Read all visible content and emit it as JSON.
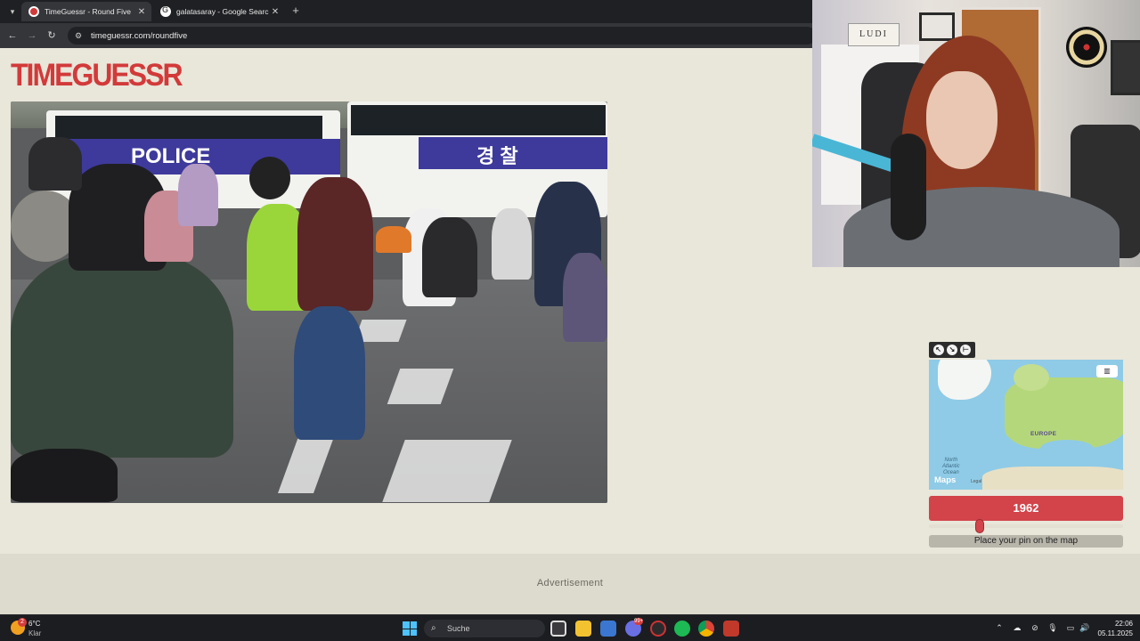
{
  "browser": {
    "tabs": [
      {
        "title": "TimeGuessr - Round Five",
        "active": true
      },
      {
        "title": "galatasaray - Google Search",
        "active": false
      }
    ],
    "url": "timeguessr.com/roundfive"
  },
  "page": {
    "logo": "TIMEGUESSR",
    "advertisement_label": "Advertisement"
  },
  "map": {
    "region_label": "EUROPE",
    "ocean_label_lines": [
      "North",
      "Atlantic",
      "Ocean"
    ],
    "brand": "Maps",
    "legal": "Legal",
    "mode_icon": "map-icon"
  },
  "guess": {
    "year": "1962",
    "slider_fraction": 0.25,
    "place_pin_label": "Place your pin on the map"
  },
  "photo": {
    "bus_left_text": "POLICE",
    "bus_right_text": "경 찰"
  },
  "webcam": {
    "sign_text": "LUDI"
  },
  "taskbar": {
    "weather_temp": "6°C",
    "weather_condition": "Klar",
    "weather_badge": "2",
    "search_placeholder": "Suche",
    "app_badge": "99+",
    "time": "22:06",
    "date": "05.11.2025"
  },
  "colors": {
    "accent_red": "#d2434a",
    "page_bg": "#e9e6da",
    "map_water": "#8fcbe6",
    "map_land": "#b5d77b"
  }
}
